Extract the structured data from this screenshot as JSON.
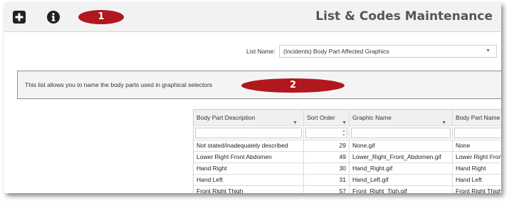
{
  "header": {
    "title": "List & Codes Maintenance",
    "icons": [
      "add-icon",
      "info-icon"
    ],
    "callout_1": "1"
  },
  "list": {
    "label": "List Name:",
    "selected": "(Incidents) Body Part Affected Graphics"
  },
  "info": {
    "text": "This list allows you to name the body parts used in graphical selectors",
    "callout_2": "2"
  },
  "grid": {
    "columns": [
      "Body Part Description",
      "Sort Order",
      "Graphic Name",
      "Body Part Name"
    ],
    "rows": [
      [
        "Not stated/inadequately described",
        "29",
        "None.gif",
        "None"
      ],
      [
        "Lower Right Front Abdomen",
        "49",
        "Lower_Right_Front_Abdomen.gif",
        "Lower Right Front"
      ],
      [
        "Hand Right",
        "30",
        "Hand_Right.gif",
        "Hand Right"
      ],
      [
        "Hand Left",
        "31",
        "Hand_Left.gif",
        "Hand Left"
      ],
      [
        "Front Right Thigh",
        "57",
        "Front_Right_Tigh.gif",
        "Front Right Thigh"
      ]
    ]
  },
  "colors": {
    "callout": "#b0171f",
    "header_bg": "#f2f2f2"
  }
}
